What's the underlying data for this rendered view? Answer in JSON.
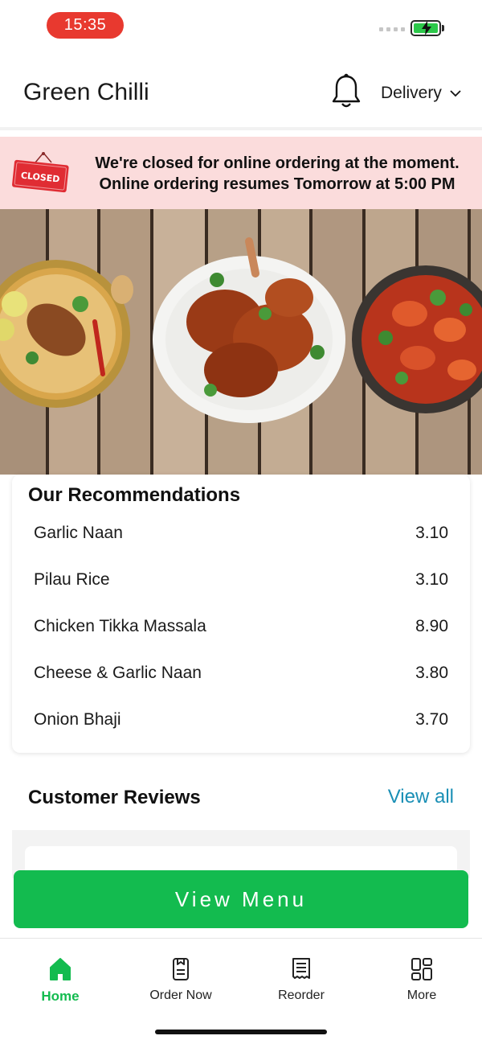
{
  "status_bar": {
    "time": "15:35",
    "time_pill_color": "#e8392f",
    "battery_color": "#2cc84a",
    "icons": [
      "signal-icon",
      "battery-charging-icon"
    ]
  },
  "header": {
    "title": "Green Chilli",
    "bell_icon": "bell-icon",
    "mode_label": "Delivery",
    "mode_icon": "chevron-down-icon"
  },
  "closed_banner": {
    "sign_text": "CLOSED",
    "line1": "We're closed for online ordering at the moment.",
    "line2": "Online ordering resumes Tomorrow at 5:00 PM",
    "background": "#fbdcdc"
  },
  "hero": {
    "description_icons": [
      "biryani-dish-image",
      "roast-chicken-dish-image",
      "curry-dish-image"
    ]
  },
  "recommendations": {
    "title": "Our Recommendations",
    "items": [
      {
        "name": "Garlic Naan",
        "price": "3.10"
      },
      {
        "name": "Pilau Rice",
        "price": "3.10"
      },
      {
        "name": "Chicken Tikka Massala",
        "price": "8.90"
      },
      {
        "name": "Cheese & Garlic Naan",
        "price": "3.80"
      },
      {
        "name": "Onion Bhaji",
        "price": "3.70"
      }
    ]
  },
  "reviews": {
    "title": "Customer Reviews",
    "view_all": "View all",
    "link_color": "#1a8fb5"
  },
  "view_menu_button": {
    "label": "View Menu",
    "color": "#13bb4f"
  },
  "bottom_nav": {
    "items": [
      {
        "label": "Home",
        "icon": "home-icon",
        "active": true
      },
      {
        "label": "Order Now",
        "icon": "order-icon",
        "active": false
      },
      {
        "label": "Reorder",
        "icon": "receipt-icon",
        "active": false
      },
      {
        "label": "More",
        "icon": "grid-icon",
        "active": false
      }
    ],
    "active_color": "#13bb4f"
  }
}
